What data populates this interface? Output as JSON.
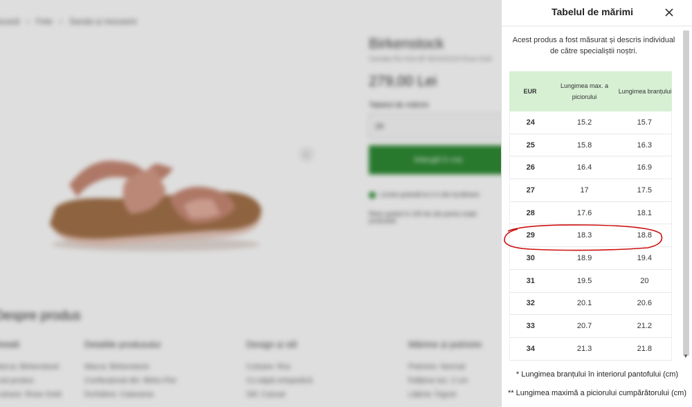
{
  "background": {
    "breadcrumb": [
      "acasă",
      "Fete",
      "Sanda și mocasini"
    ],
    "brand": "Birkenstock",
    "subline": "Sandale Rio Kids BF BS1002104 Rose Gold",
    "price": "279,00 Lei",
    "size_label": "Tabelul de mărimi",
    "size_value": "29",
    "add_to_cart": "Adaugă în coș",
    "stock_text": "Livrare gratuită la 2-4 zile lucrătoare",
    "delivery_text": "Retur gratuit în 100 de zile pentru toate produsele",
    "section_title": "Despre produs",
    "columns": [
      {
        "heading": "Detalii",
        "lines": [
          "Marca: Birkenstock",
          "Cod produs",
          "Culoare: Rose Gold"
        ]
      },
      {
        "heading": "Detaliile produsului",
        "lines": [
          "Marca: Birkenstock",
          "Confecționat din: Birko-Flor",
          "Închidere: Catarama"
        ]
      },
      {
        "heading": "Design și stil",
        "lines": [
          "Culoare: Roz",
          "Cu talpă ortopedică",
          "Stil: Casual"
        ]
      },
      {
        "heading": "Mărime și potrivire",
        "lines": [
          "Potrivire: Normal",
          "Înălțime toc: 2 cm",
          "Lățime: Îngust"
        ]
      }
    ],
    "image_nav_icon": "chevron-left-icon",
    "colors": {
      "green": "#2e8b34",
      "overlay": "#00000021"
    }
  },
  "size_modal": {
    "title": "Tabelul de mărimi",
    "close_icon": "close-icon",
    "intro": "Acest produs a fost măsurat și descris individual de către specialiștii noștri.",
    "headers": {
      "eur": "EUR",
      "foot_length": "Lungimea max. a piciorului",
      "insole_length": "Lungimea branțului"
    },
    "rows": [
      {
        "eur": "24",
        "foot": "15.2",
        "insole": "15.7"
      },
      {
        "eur": "25",
        "foot": "15.8",
        "insole": "16.3"
      },
      {
        "eur": "26",
        "foot": "16.4",
        "insole": "16.9"
      },
      {
        "eur": "27",
        "foot": "17",
        "insole": "17.5"
      },
      {
        "eur": "28",
        "foot": "17.6",
        "insole": "18.1"
      },
      {
        "eur": "29",
        "foot": "18.3",
        "insole": "18.8"
      },
      {
        "eur": "30",
        "foot": "18.9",
        "insole": "19.4"
      },
      {
        "eur": "31",
        "foot": "19.5",
        "insole": "20"
      },
      {
        "eur": "32",
        "foot": "20.1",
        "insole": "20.6"
      },
      {
        "eur": "33",
        "foot": "20.7",
        "insole": "21.2"
      },
      {
        "eur": "34",
        "foot": "21.3",
        "insole": "21.8"
      }
    ],
    "highlighted_eur": "29",
    "footnote_insole": "* Lungimea branțului în interiorul pantofului (cm)",
    "footnote_foot": "** Lungimea maximă a piciorului cumpărătorului (cm)",
    "colors": {
      "header_bg": "#d7f0d4",
      "annotation": "#cc1111"
    }
  }
}
